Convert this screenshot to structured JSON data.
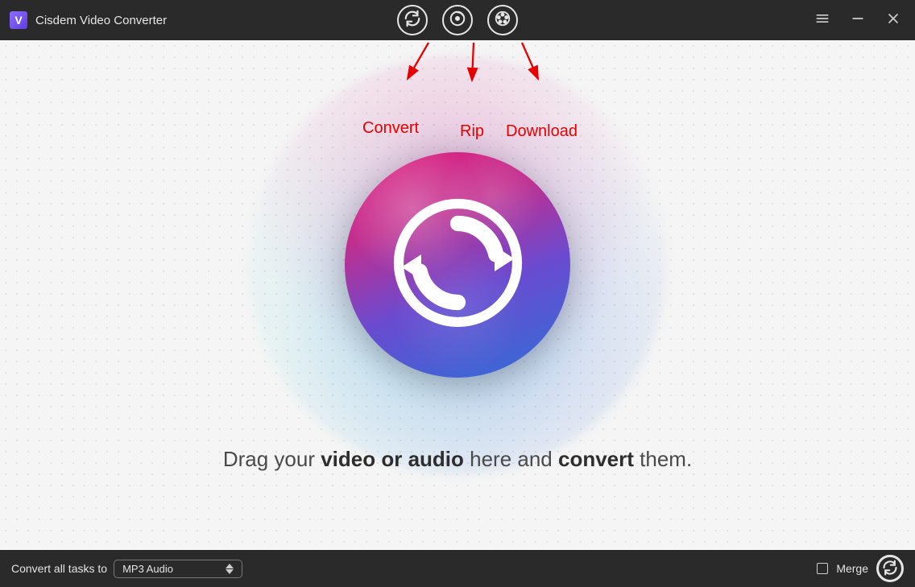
{
  "app": {
    "title": "Cisdem Video Converter",
    "logo_letter": "V"
  },
  "modes": {
    "convert": {
      "name": "convert",
      "annotation": "Convert"
    },
    "rip": {
      "name": "rip",
      "annotation": "Rip"
    },
    "download": {
      "name": "download",
      "annotation": "Download"
    }
  },
  "drop_hint": {
    "pre": "Drag your ",
    "bold1": "video or audio",
    "mid": " here and ",
    "bold2": "convert",
    "post": " them."
  },
  "bottom": {
    "label": "Convert all tasks to",
    "selected_format": "MP3 Audio",
    "merge_label": "Merge",
    "merge_checked": false
  },
  "colors": {
    "titlebar_bg": "#2a2a2a",
    "accent_red": "#e60000",
    "medallion_gradient_from": "#e3237f",
    "medallion_gradient_to": "#2f6fd6"
  }
}
